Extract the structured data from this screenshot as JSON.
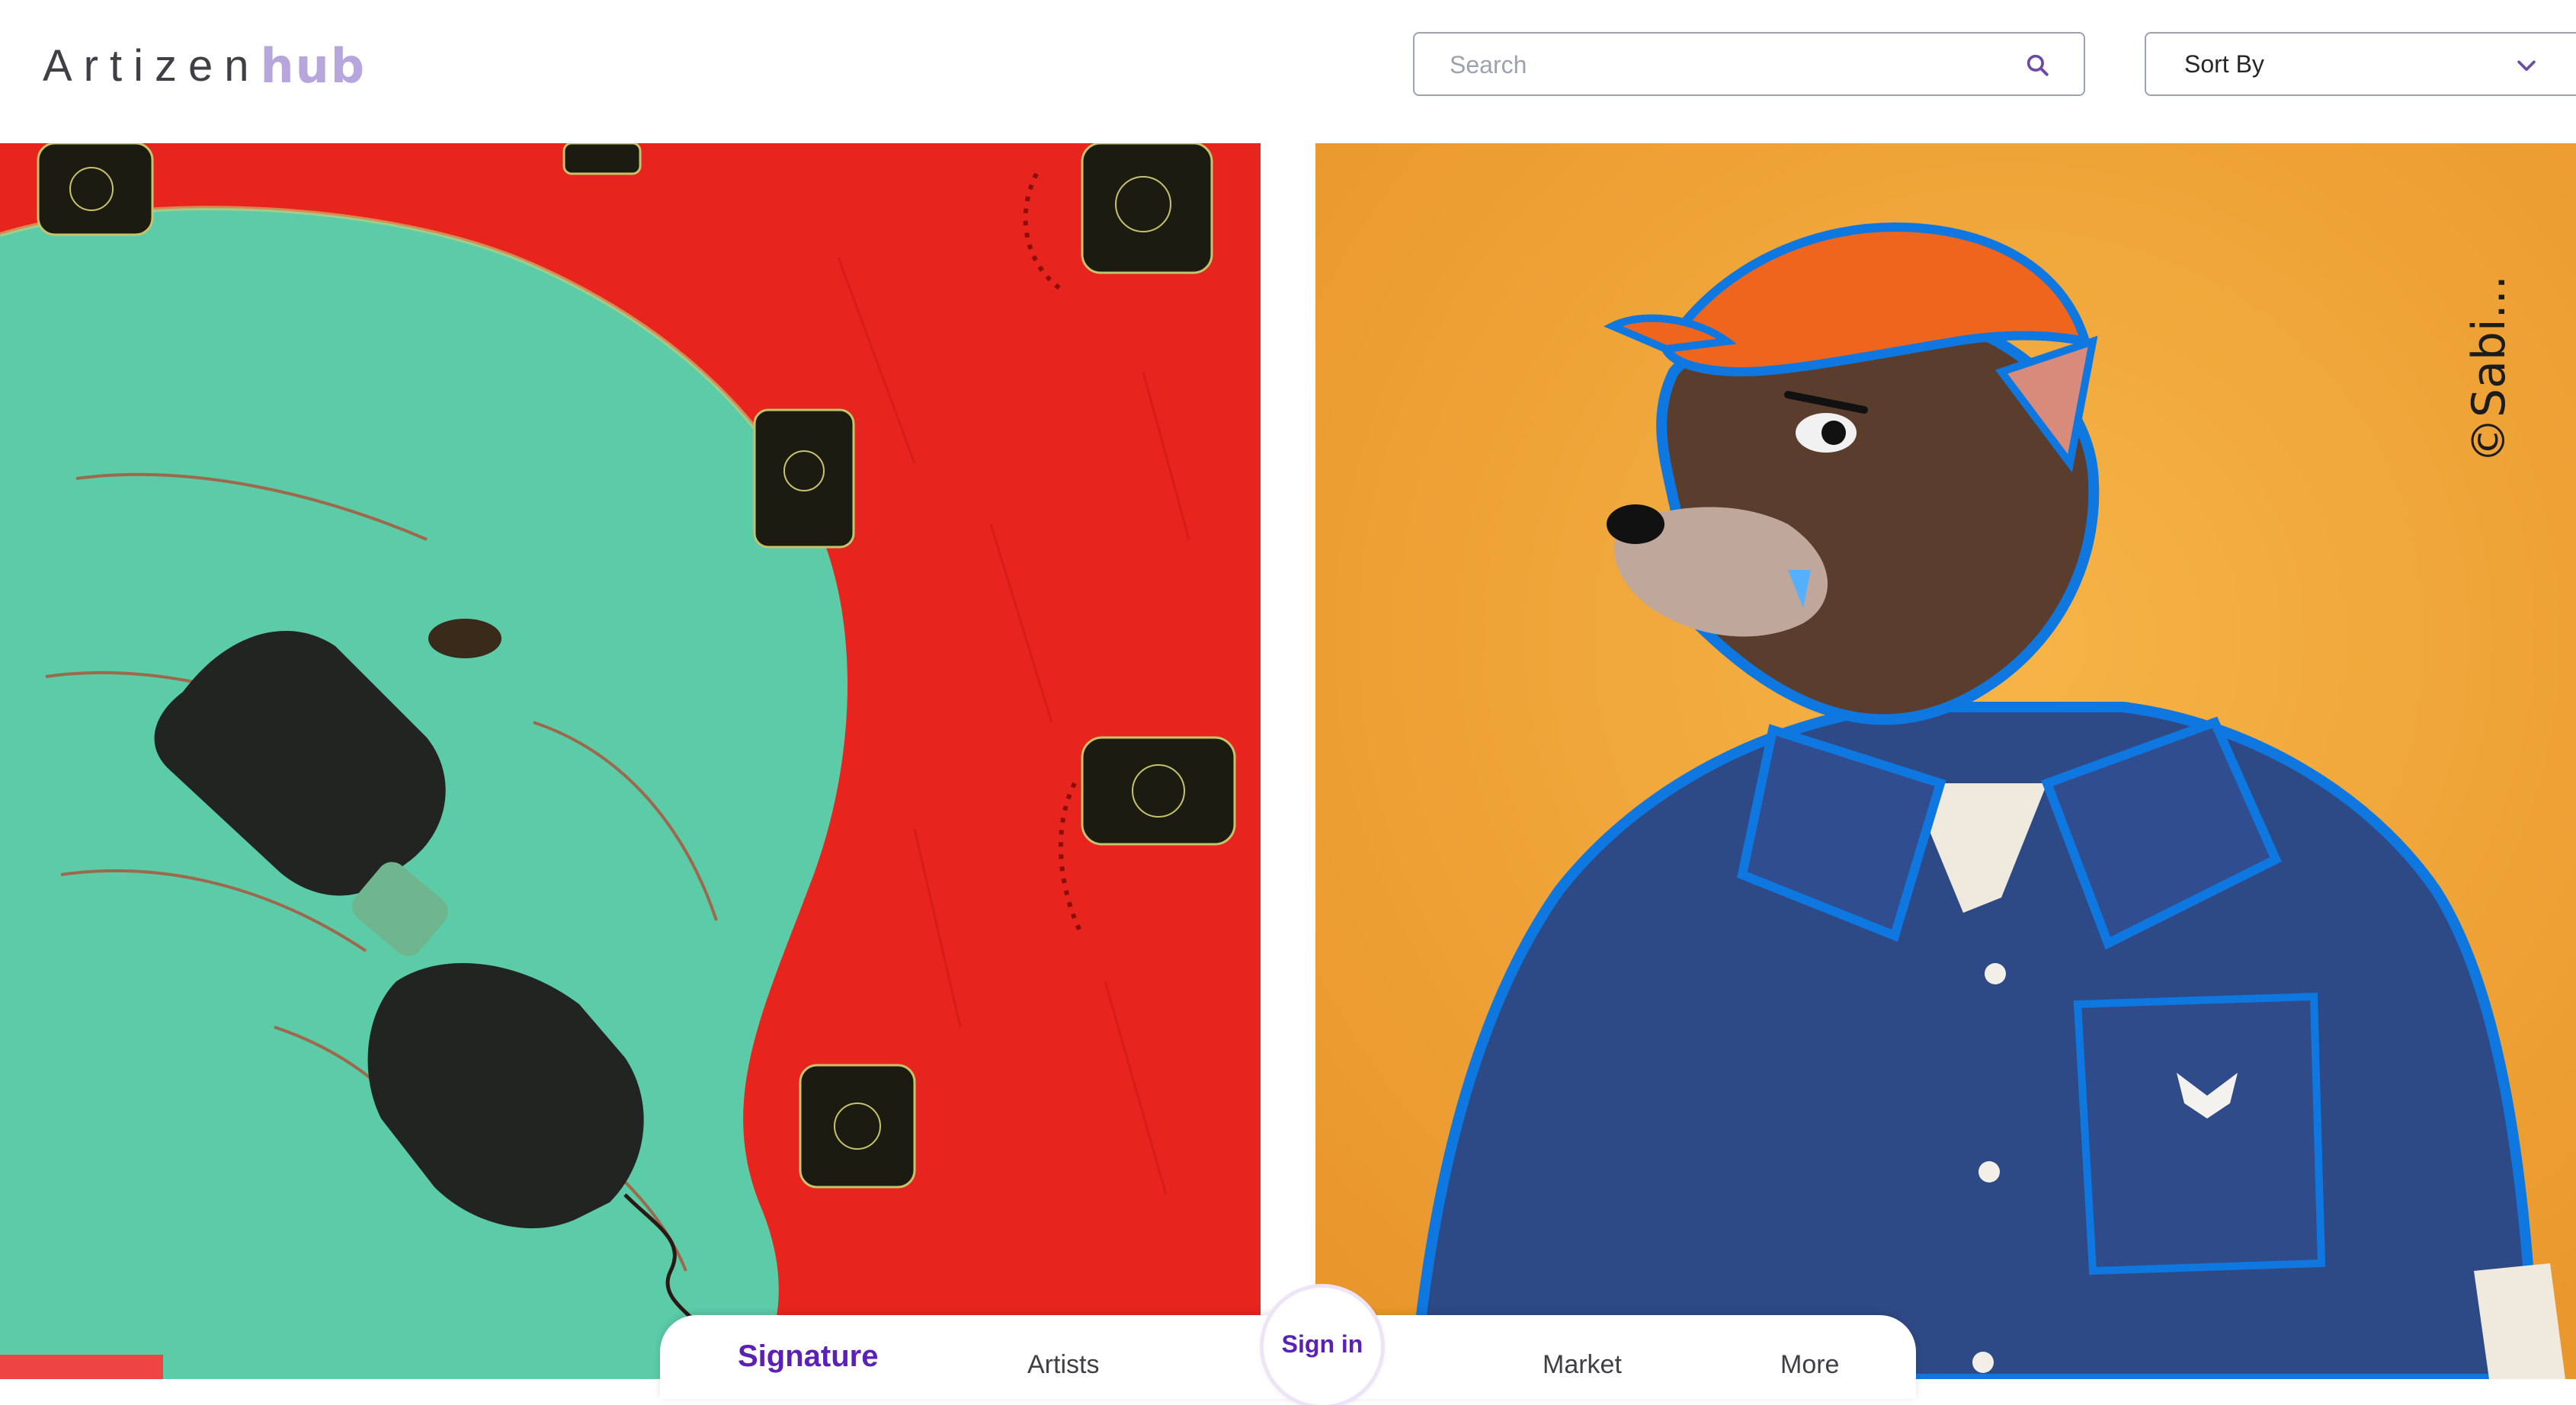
{
  "header": {
    "logo_text": "Artizen",
    "logo_accent": "hub",
    "search_placeholder": "Search",
    "sort_label": "Sort By",
    "search_icon": "search-icon",
    "sort_icon": "chevron-down-icon"
  },
  "artworks": [
    {
      "subject": "Elephant with telephone receiver",
      "signature_text": ""
    },
    {
      "subject": "Wolf in orange cap and blue shirt",
      "signature_text": "©Sabi..."
    }
  ],
  "bottom_nav": {
    "items": [
      {
        "label": "Signature",
        "active": true
      },
      {
        "label": "Artists",
        "active": false
      },
      {
        "label": "Market",
        "active": false
      },
      {
        "label": "More",
        "active": false
      }
    ],
    "sign_in_label": "Sign in"
  },
  "colors": {
    "accent": "#5b21b6",
    "logo_accent": "#b7a6db",
    "left_art_bg": "#e8241f",
    "left_art_elephant": "#5ccba8",
    "right_art_bg": "#f3a532",
    "right_art_shirt": "#2e4a86",
    "right_art_cap": "#f0651e"
  }
}
